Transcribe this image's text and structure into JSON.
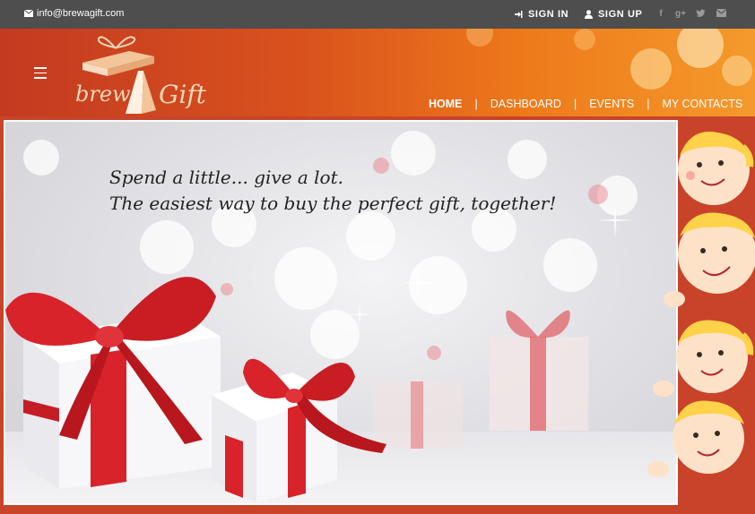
{
  "topbar": {
    "email": "info@brewagift.com",
    "sign_in": "SIGN IN",
    "sign_up": "SIGN UP",
    "social_icons": [
      "facebook-icon",
      "google-plus-icon",
      "twitter-icon",
      "email-icon"
    ],
    "background": "#4e4e4e"
  },
  "header": {
    "logo_text_1": "brew",
    "logo_text_2": "A",
    "logo_text_3": "Gift",
    "nav": [
      {
        "label": "HOME",
        "active": true
      },
      {
        "label": "DASHBOARD"
      },
      {
        "label": "EVENTS"
      },
      {
        "label": "MY CONTACTS"
      }
    ],
    "separator": "|",
    "gradient": [
      "#c33a21",
      "#ee7a1a",
      "#f49a2c"
    ]
  },
  "hero": {
    "line1": "Spend a little... give a lot.",
    "line2": "The easiest way to buy the perfect gift, together!",
    "accent": "#d8232a"
  }
}
